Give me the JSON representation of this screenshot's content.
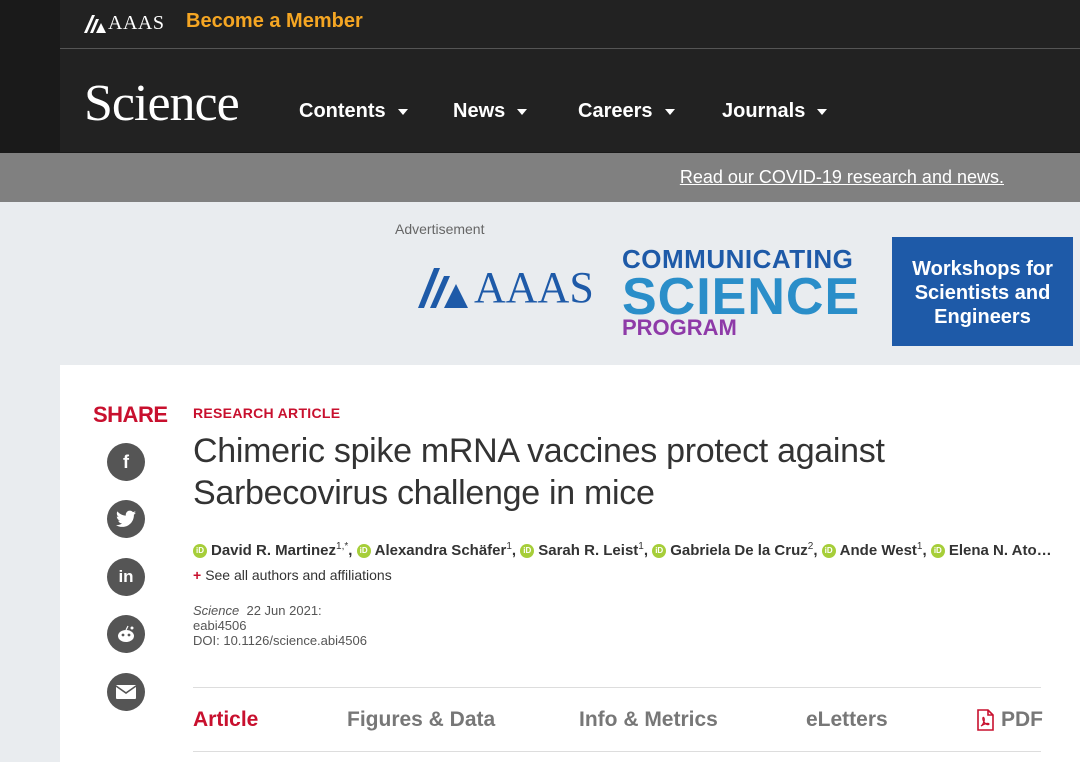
{
  "topbar": {
    "aaas_logo": "AAAS",
    "become_member": "Become a Member"
  },
  "header": {
    "logo": "Science",
    "nav": [
      {
        "label": "Contents"
      },
      {
        "label": "News"
      },
      {
        "label": "Careers"
      },
      {
        "label": "Journals"
      }
    ]
  },
  "covid_link": "Read our COVID-19 research and news.",
  "ad": {
    "label": "Advertisement",
    "aaas": "AAAS",
    "line1": "COMMUNICATING",
    "line2": "SCIENCE",
    "line3": "PROGRAM",
    "workshop": "Workshops for Scientists and Engineers"
  },
  "share": {
    "label": "SHARE",
    "buttons": [
      "facebook",
      "twitter",
      "linkedin",
      "reddit",
      "email"
    ]
  },
  "article": {
    "kicker": "RESEARCH ARTICLE",
    "title": "Chimeric spike mRNA vaccines protect against Sarbecovirus challenge in mice",
    "authors": [
      {
        "name": "David R. Martinez",
        "sup": "1,*"
      },
      {
        "name": "Alexandra Schäfer",
        "sup": "1"
      },
      {
        "name": "Sarah R. Leist",
        "sup": "1"
      },
      {
        "name": "Gabriela De la Cruz",
        "sup": "2"
      },
      {
        "name": "Ande West",
        "sup": "1"
      },
      {
        "name": "Elena N. Ato…",
        "sup": ""
      }
    ],
    "see_all": "See all authors and affiliations",
    "journal": "Science",
    "date": "22 Jun 2021:",
    "id": "eabi4506",
    "doi": "DOI: 10.1126/science.abi4506"
  },
  "tabs": [
    {
      "label": "Article",
      "active": true
    },
    {
      "label": "Figures & Data"
    },
    {
      "label": "Info & Metrics"
    },
    {
      "label": "eLetters"
    },
    {
      "label": "PDF"
    }
  ],
  "colors": {
    "accent": "#c8102e",
    "member": "#f5a623",
    "dark": "#222222",
    "orcid": "#a6ce39",
    "ad_blue": "#1e5aa8"
  }
}
